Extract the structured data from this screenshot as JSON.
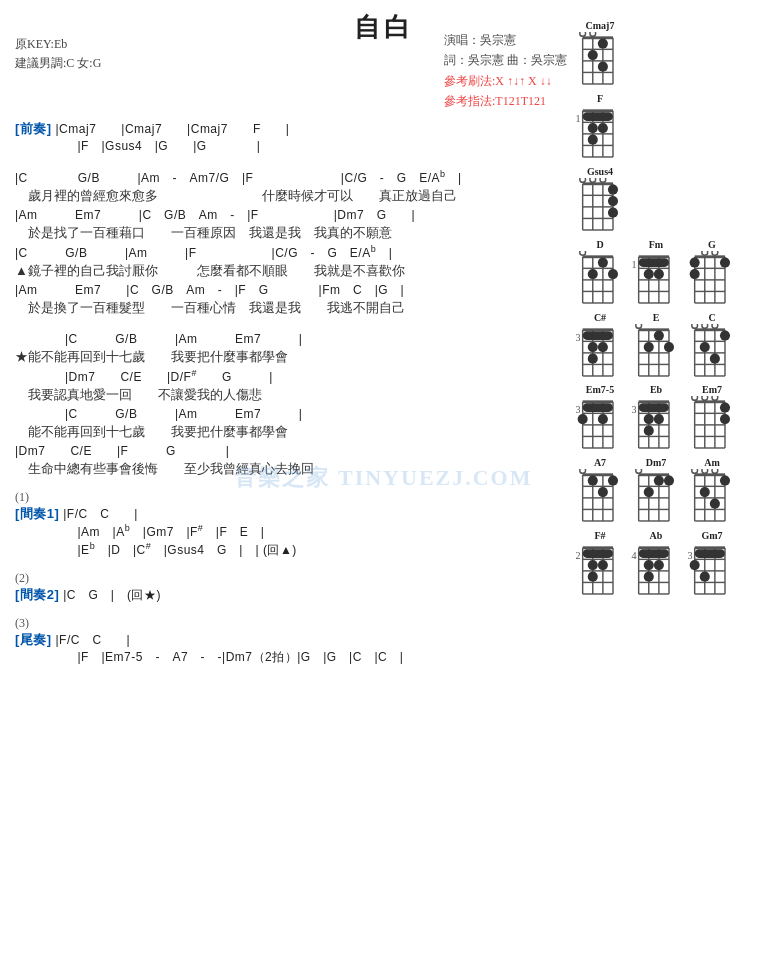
{
  "title": "自白",
  "meta_left": {
    "key": "原KEY:Eb",
    "suggestion": "建議男調:C 女:G"
  },
  "meta_right": {
    "singer": "演唱：吳宗憲",
    "lyricist": "詞：吳宗憲  曲：吳宗憲",
    "ref1": "參考刷法:X ↑↓↑ X ↓↓",
    "ref2": "參考指法:T121T121"
  },
  "watermark": "音樂之家 TINYUEZJ.COM",
  "chords": [
    {
      "name": "Cmaj7",
      "row": 0,
      "dots": [
        [
          1,
          1
        ],
        [
          1,
          2
        ],
        [
          1,
          3
        ],
        [
          1,
          4
        ]
      ],
      "open": [
        0,
        1,
        2
      ],
      "mute": []
    },
    {
      "name": "F",
      "row": 1
    },
    {
      "name": "Gsus4",
      "row": 2
    },
    {
      "name": "D",
      "row": 3
    },
    {
      "name": "Fm",
      "row": 3
    },
    {
      "name": "G",
      "row": 3
    },
    {
      "name": "C#",
      "row": 4
    },
    {
      "name": "E",
      "row": 4
    },
    {
      "name": "C",
      "row": 4
    },
    {
      "name": "Em7-5",
      "row": 5
    },
    {
      "name": "Eb",
      "row": 5
    },
    {
      "name": "Em7",
      "row": 5
    },
    {
      "name": "A7",
      "row": 6
    },
    {
      "name": "Dm7",
      "row": 6
    },
    {
      "name": "Am",
      "row": 6
    },
    {
      "name": "F#",
      "row": 7
    },
    {
      "name": "Ab",
      "row": 7
    },
    {
      "name": "Gm7",
      "row": 7
    }
  ]
}
